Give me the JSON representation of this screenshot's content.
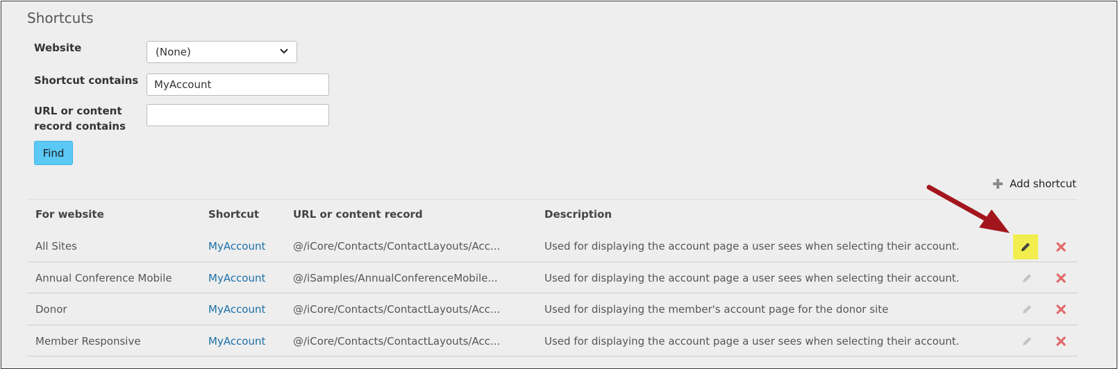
{
  "page": {
    "title": "Shortcuts"
  },
  "form": {
    "website_label": "Website",
    "website_value": "(None)",
    "shortcut_label": "Shortcut contains",
    "shortcut_value": "MyAccount",
    "url_label_line1": "URL or content",
    "url_label_line2": "record contains",
    "url_value": "",
    "find_label": "Find"
  },
  "actions": {
    "add_shortcut_label": "Add shortcut"
  },
  "table": {
    "headers": {
      "website": "For website",
      "shortcut": "Shortcut",
      "url": "URL or content record",
      "description": "Description"
    },
    "rows": [
      {
        "website": "All Sites",
        "shortcut": "MyAccount",
        "url": "@/iCore/Contacts/ContactLayouts/Acc...",
        "description": "Used for displaying the account page a user sees when selecting their account."
      },
      {
        "website": "Annual Conference Mobile",
        "shortcut": "MyAccount",
        "url": "@/iSamples/AnnualConferenceMobile...",
        "description": "Used for displaying the account page a user sees when selecting their account."
      },
      {
        "website": "Donor",
        "shortcut": "MyAccount",
        "url": "@/iCore/Contacts/ContactLayouts/Acc...",
        "description": "Used for displaying the member's account page for the donor site"
      },
      {
        "website": "Member Responsive",
        "shortcut": "MyAccount",
        "url": "@/iCore/Contacts/ContactLayouts/Acc...",
        "description": "Used for displaying the account page a user sees when selecting their account."
      }
    ]
  },
  "icons": {
    "edit": "pencil-icon",
    "delete": "x-icon",
    "add": "plus-icon",
    "select": "chevron-down-icon",
    "annotation": "red-arrow-annotation"
  },
  "colors": {
    "link": "#1a6fa8",
    "find_button": "#5bc8f5",
    "highlight": "#f3ee4f",
    "delete": "#e06a6a",
    "annotation_arrow": "#a3151c"
  }
}
